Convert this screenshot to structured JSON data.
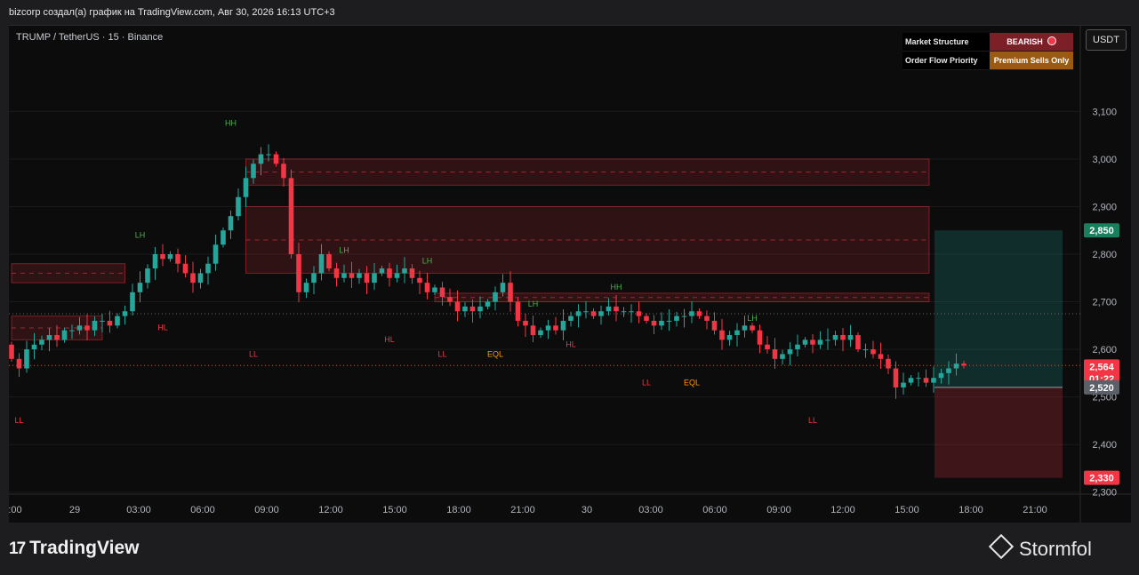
{
  "header": {
    "publisher_line": "bizcorp создал(а) график на TradingView.com, Авг 30, 2026 16:13 UTC+3"
  },
  "symbol_line": "TRUMP / TetherUS · 15 · Binance",
  "currency_button": "USDT",
  "status_table": {
    "rows": [
      {
        "label": "Market Structure",
        "value": "BEARISH",
        "color": "#7d1f27"
      },
      {
        "label": "Order Flow Priority",
        "value": "Premium Sells Only",
        "color": "#9a5a12"
      }
    ]
  },
  "footer": {
    "brand": "TradingView",
    "watermark": "Stormfol"
  },
  "colors": {
    "up": "#26a69a",
    "down": "#f23645",
    "bg": "#0c0c0c"
  },
  "chart_data": {
    "type": "candlestick",
    "x_ticks": [
      ":00",
      "29",
      "03:00",
      "06:00",
      "09:00",
      "12:00",
      "15:00",
      "18:00",
      "21:00",
      "30",
      "03:00",
      "06:00",
      "09:00",
      "12:00",
      "15:00",
      "18:00",
      "21:00"
    ],
    "y_ticks": [
      "3,100",
      "3,000",
      "2,900",
      "2,800",
      "2,700",
      "2,600",
      "2,500",
      "2,400",
      "2,300"
    ],
    "y_tick_values": [
      3.1,
      3.0,
      2.9,
      2.8,
      2.7,
      2.6,
      2.5,
      2.4,
      2.3
    ],
    "ylim": [
      2.236,
      3.28
    ],
    "price_labels": [
      {
        "text": "2,850",
        "value": 2.85,
        "color": "#1a7f5c"
      },
      {
        "text": "2,564",
        "value": 2.564,
        "color": "#f23645"
      },
      {
        "text": "01:22",
        "value": 2.539,
        "color": "#f23645"
      },
      {
        "text": "2,520",
        "value": 2.52,
        "color": "#5a5f68"
      },
      {
        "text": "2,330",
        "value": 2.33,
        "color": "#f23645"
      }
    ],
    "close_series": [
      2.58,
      2.56,
      2.6,
      2.61,
      2.62,
      2.63,
      2.62,
      2.64,
      2.64,
      2.65,
      2.64,
      2.66,
      2.66,
      2.65,
      2.67,
      2.68,
      2.72,
      2.74,
      2.77,
      2.8,
      2.79,
      2.8,
      2.78,
      2.76,
      2.74,
      2.76,
      2.78,
      2.82,
      2.85,
      2.88,
      2.92,
      2.96,
      2.99,
      3.01,
      3.01,
      2.99,
      2.96,
      2.8,
      2.72,
      2.74,
      2.76,
      2.8,
      2.77,
      2.75,
      2.76,
      2.75,
      2.76,
      2.74,
      2.76,
      2.77,
      2.75,
      2.76,
      2.77,
      2.75,
      2.74,
      2.72,
      2.73,
      2.71,
      2.7,
      2.68,
      2.69,
      2.68,
      2.69,
      2.7,
      2.72,
      2.74,
      2.7,
      2.66,
      2.65,
      2.63,
      2.64,
      2.65,
      2.64,
      2.66,
      2.67,
      2.68,
      2.68,
      2.67,
      2.68,
      2.69,
      2.68,
      2.68,
      2.68,
      2.67,
      2.66,
      2.65,
      2.66,
      2.66,
      2.67,
      2.67,
      2.68,
      2.67,
      2.66,
      2.64,
      2.62,
      2.63,
      2.64,
      2.65,
      2.64,
      2.61,
      2.6,
      2.58,
      2.59,
      2.6,
      2.61,
      2.62,
      2.61,
      2.62,
      2.62,
      2.63,
      2.62,
      2.63,
      2.6,
      2.6,
      2.59,
      2.58,
      2.56,
      2.52,
      2.53,
      2.54,
      2.54,
      2.53,
      2.54,
      2.55,
      2.56,
      2.57,
      2.566
    ],
    "markers": [
      {
        "text": "HH",
        "time_index": 29,
        "value": 3.07,
        "color": "#4caf50"
      },
      {
        "text": "LH",
        "time_index": 17,
        "value": 2.835,
        "color": "#4caf50"
      },
      {
        "text": "LH",
        "time_index": 44,
        "value": 2.803,
        "color": "#4caf50"
      },
      {
        "text": "LH",
        "time_index": 55,
        "value": 2.78,
        "color": "#4caf50"
      },
      {
        "text": "LH",
        "time_index": 69,
        "value": 2.69,
        "color": "#4caf50"
      },
      {
        "text": "HH",
        "time_index": 80,
        "value": 2.725,
        "color": "#4caf50"
      },
      {
        "text": "LH",
        "time_index": 98,
        "value": 2.66,
        "color": "#4caf50"
      },
      {
        "text": "LL",
        "time_index": 1,
        "value": 2.445,
        "color": "#f23645"
      },
      {
        "text": "HL",
        "time_index": 20,
        "value": 2.64,
        "color": "#f23645"
      },
      {
        "text": "LL",
        "time_index": 32,
        "value": 2.584,
        "color": "#f23645"
      },
      {
        "text": "HL",
        "time_index": 50,
        "value": 2.615,
        "color": "#f23645"
      },
      {
        "text": "LL",
        "time_index": 57,
        "value": 2.584,
        "color": "#f23645"
      },
      {
        "text": "EQL",
        "time_index": 64,
        "value": 2.584,
        "color": "#ff9800"
      },
      {
        "text": "HL",
        "time_index": 74,
        "value": 2.605,
        "color": "#f23645"
      },
      {
        "text": "LL",
        "time_index": 84,
        "value": 2.525,
        "color": "#f23645"
      },
      {
        "text": "EQL",
        "time_index": 90,
        "value": 2.525,
        "color": "#ff9800"
      },
      {
        "text": "LL",
        "time_index": 106,
        "value": 2.445,
        "color": "#f23645"
      }
    ],
    "supply_zones": [
      {
        "from": 31,
        "to": "end",
        "top": 3.0,
        "bottom": 2.945
      },
      {
        "from": 31,
        "to": "end",
        "top": 2.9,
        "bottom": 2.76
      },
      {
        "from": 0,
        "to": 15,
        "top": 2.78,
        "bottom": 2.74
      },
      {
        "from": 56,
        "to": "end",
        "top": 2.718,
        "bottom": 2.7
      },
      {
        "from": 0,
        "to": 12,
        "top": 2.67,
        "bottom": 2.62
      }
    ],
    "position_tool": {
      "entry": 2.52,
      "target": 2.85,
      "stop": 2.33
    }
  }
}
